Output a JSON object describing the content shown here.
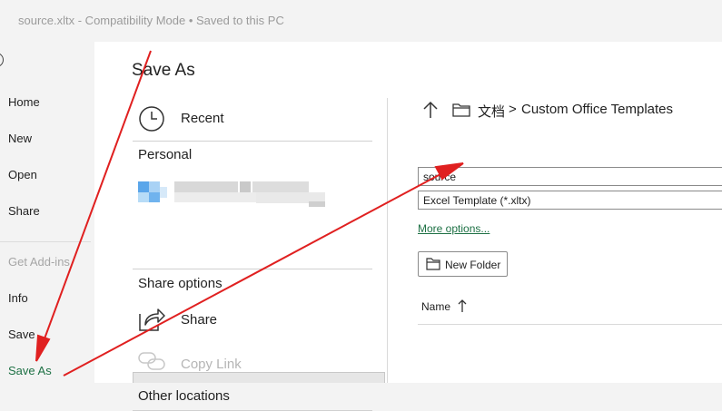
{
  "titlebar": {
    "title": "source.xltx  -  Compatibility Mode • Saved to this PC"
  },
  "sidebar": {
    "items": [
      {
        "label": "Home"
      },
      {
        "label": "New"
      },
      {
        "label": "Open"
      },
      {
        "label": "Share"
      },
      {
        "label": "Get Add-ins"
      },
      {
        "label": "Info"
      },
      {
        "label": "Save"
      },
      {
        "label": "Save As"
      }
    ]
  },
  "main": {
    "title": "Save As",
    "locations": {
      "recent": "Recent",
      "personal": "Personal",
      "share_options": "Share options",
      "share": "Share",
      "copy_link": "Copy Link",
      "other_locations": "Other locations"
    },
    "path": {
      "folder": "文档",
      "separator": ">",
      "current": "Custom Office Templates"
    },
    "filename": {
      "value": "source"
    },
    "filetype": {
      "value": "Excel Template (*.xltx)"
    },
    "more_options": "More options...",
    "new_folder": "New Folder",
    "column_name": "Name",
    "icons": [
      "back-arrow-icon",
      "clock-icon",
      "share-icon",
      "link-icon",
      "up-arrow-icon",
      "folder-icon",
      "sort-arrow-icon"
    ],
    "accent_color": "#1e7145",
    "annotation_color": "#e02020"
  }
}
